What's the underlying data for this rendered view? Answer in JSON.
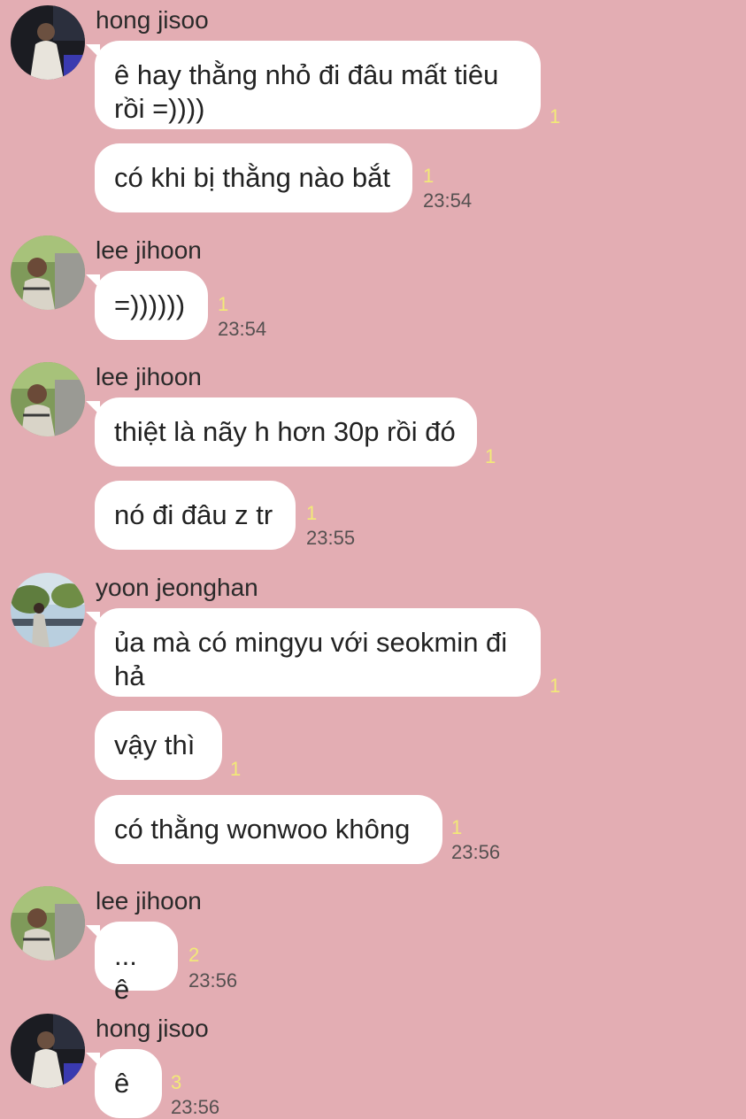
{
  "messages": [
    {
      "sender": "hong jisoo",
      "bubbles": [
        {
          "text": "ê hay thằng nhỏ đi đâu mất tiêu\nrồi =))))",
          "unread": "1",
          "time": ""
        },
        {
          "text": "có khi bị thằng nào bắt",
          "unread": "1",
          "time": "23:54"
        }
      ]
    },
    {
      "sender": "lee jihoon",
      "bubbles": [
        {
          "text": "=))))))",
          "unread": "1",
          "time": "23:54"
        }
      ]
    },
    {
      "sender": "lee jihoon",
      "bubbles": [
        {
          "text": "thiệt là nãy h hơn 30p rồi đó",
          "unread": "1",
          "time": ""
        },
        {
          "text": "nó đi đâu z tr",
          "unread": "1",
          "time": "23:55"
        }
      ]
    },
    {
      "sender": "yoon jeonghan",
      "bubbles": [
        {
          "text": "ủa mà có mingyu với seokmin đi\nhả",
          "unread": "1",
          "time": ""
        },
        {
          "text": "vậy thì",
          "unread": "1",
          "time": ""
        },
        {
          "text": "có thằng wonwoo không",
          "unread": "1",
          "time": "23:56"
        }
      ]
    },
    {
      "sender": "lee jihoon",
      "bubbles": [
        {
          "text": "... ê",
          "unread": "2",
          "time": "23:56"
        }
      ]
    },
    {
      "sender": "hong jisoo",
      "bubbles": [
        {
          "text": "ê",
          "unread": "3",
          "time": "23:56"
        }
      ]
    }
  ]
}
